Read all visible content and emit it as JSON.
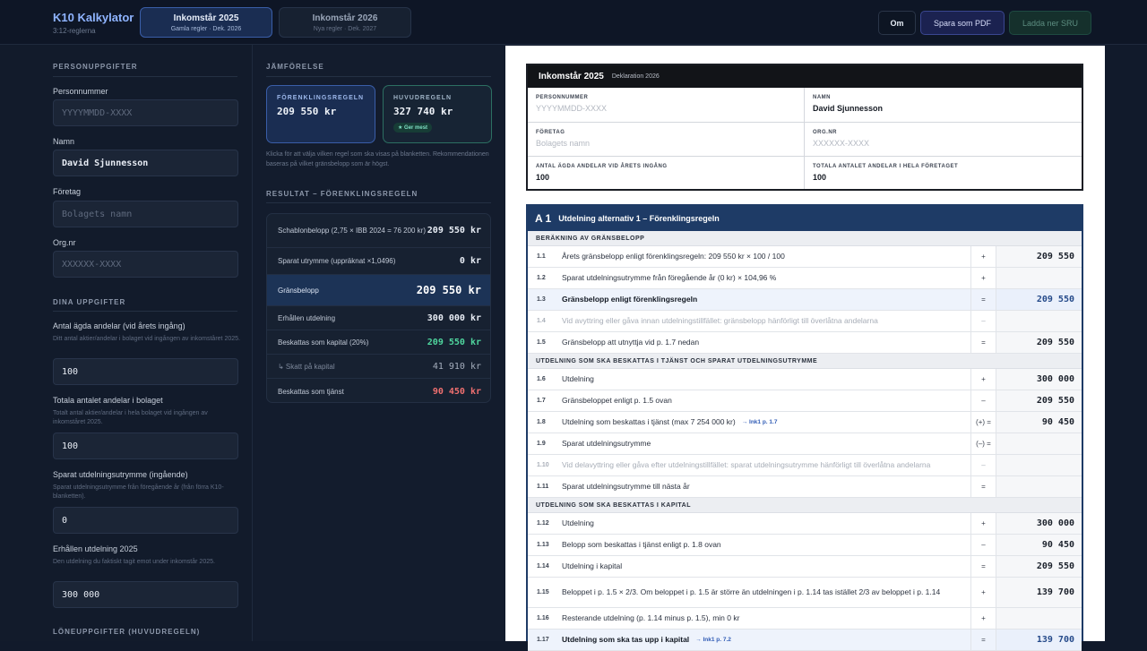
{
  "header": {
    "app_title": "K10 Kalkylator",
    "app_subtitle": "3:12-reglerna",
    "tabs": [
      {
        "label": "Inkomstår 2025",
        "sub": "Gamla regler · Dek. 2026"
      },
      {
        "label": "Inkomstår 2026",
        "sub": "Nya regler · Dek. 2027"
      }
    ],
    "buttons": {
      "about": "Om",
      "save_pdf": "Spara som PDF",
      "download_sru": "Ladda ner SRU"
    }
  },
  "left": {
    "personal_title": "PERSONUPPGIFTER",
    "personnummer_label": "Personnummer",
    "personnummer_placeholder": "YYYYMMDD-XXXX",
    "namn_label": "Namn",
    "namn_value": "David Sjunnesson",
    "foretag_label": "Företag",
    "foretag_placeholder": "Bolagets namn",
    "orgnr_label": "Org.nr",
    "orgnr_placeholder": "XXXXXX-XXXX",
    "dina_title": "DINA UPPGIFTER",
    "antal_label": "Antal ägda andelar (vid årets ingång)",
    "antal_help": "Ditt antal aktier/andelar i bolaget vid ingången av inkomståret 2025.",
    "antal_value": "100",
    "totala_label": "Totala antalet andelar i bolaget",
    "totala_help": "Totalt antal aktier/andelar i hela bolaget vid ingången av inkomståret 2025.",
    "totala_value": "100",
    "sparat_label": "Sparat utdelningsutrymme (ingående)",
    "sparat_help": "Sparat utdelningsutrymme från föregående år (från förra K10-blanketten).",
    "sparat_value": "0",
    "erhallen_label": "Erhållen utdelning 2025",
    "erhallen_help": "Den utdelning du faktiskt tagit emot under inkomstår 2025.",
    "erhallen_value": "300 000",
    "lone_title": "LÖNEUPPGIFTER (HUVUDREGELN)"
  },
  "middle": {
    "jamforelse_title": "JÄMFÖRELSE",
    "forenkling_label": "FÖRENKLINGSREGELN",
    "forenkling_value": "209 550 kr",
    "huvud_label": "HUVUDREGELN",
    "huvud_value": "327 740 kr",
    "badge": "★ Ger mest",
    "note": "Klicka för att välja vilken regel som ska visas på blanketten. Rekommendationen baseras på vilket gränsbelopp som är högst.",
    "resultat_title": "RESULTAT – FÖRENKLINGSREGELN",
    "rows": [
      {
        "label": "Schablonbelopp (2,75 × IBB 2024 = 76 200 kr)",
        "value": "209 550 kr"
      },
      {
        "label": "Sparat utrymme (uppräknat ×1,0496)",
        "value": "0 kr"
      },
      {
        "label": "Gränsbelopp",
        "value": "209 550 kr"
      },
      {
        "label": "Erhållen utdelning",
        "value": "300 000 kr"
      },
      {
        "label": "Beskattas som kapital (20%)",
        "value": "209 550 kr"
      },
      {
        "label": "↳ Skatt på kapital",
        "value": "41 910 kr"
      },
      {
        "label": "Beskattas som tjänst",
        "value": "90 450 kr"
      }
    ]
  },
  "paper": {
    "year_title": "Inkomstår 2025",
    "year_sub": "Deklaration 2026",
    "personnummer_label": "PERSONNUMMER",
    "personnummer_value": "YYYYMMDD-XXXX",
    "namn_label": "NAMN",
    "namn_value": "David Sjunnesson",
    "foretag_label": "FÖRETAG",
    "foretag_value": "Bolagets namn",
    "orgnr_label": "ORG.NR",
    "orgnr_value": "XXXXXX-XXXX",
    "antal_label": "ANTAL ÄGDA ANDELAR VID ÅRETS INGÅNG",
    "antal_value": "100",
    "totala_label": "TOTALA ANTALET ANDELAR I HELA FÖRETAGET",
    "totala_value": "100",
    "a1_num": "A 1",
    "a1_title": "Utdelning alternativ 1 – Förenklingsregeln",
    "groups": {
      "g1": "BERÄKNING AV GRÄNSBELOPP",
      "g2": "UTDELNING SOM SKA BESKATTAS I TJÄNST OCH SPARAT UTDELNINGSUTRYMME",
      "g3": "UTDELNING SOM SKA BESKATTAS I KAPITAL"
    },
    "lines": [
      {
        "no": "1.1",
        "text": "Årets gränsbelopp enligt förenklingsregeln: 209 550 kr × 100 / 100",
        "op": "+",
        "val": "209 550"
      },
      {
        "no": "1.2",
        "text": "Sparat utdelningsutrymme från föregående år (0 kr) × 104,96 %",
        "op": "+",
        "val": ""
      },
      {
        "no": "1.3",
        "text": "Gränsbelopp enligt förenklingsregeln",
        "op": "=",
        "val": "209 550"
      },
      {
        "no": "1.4",
        "text": "Vid avyttring eller gåva innan utdelningstillfället: gränsbelopp hänförligt till överlåtna andelarna",
        "op": "–",
        "val": ""
      },
      {
        "no": "1.5",
        "text": "Gränsbelopp att utnyttja vid p. 1.7 nedan",
        "op": "=",
        "val": "209 550"
      },
      {
        "no": "1.6",
        "text": "Utdelning",
        "op": "+",
        "val": "300 000"
      },
      {
        "no": "1.7",
        "text": "Gränsbeloppet enligt p. 1.5 ovan",
        "op": "–",
        "val": "209 550"
      },
      {
        "no": "1.8",
        "text": "Utdelning som beskattas i tjänst (max 7 254 000 kr)",
        "ink": "→ Ink1 p. 1.7",
        "op": "(+) =",
        "val": "90 450"
      },
      {
        "no": "1.9",
        "text": "Sparat utdelningsutrymme",
        "op": "(–) =",
        "val": ""
      },
      {
        "no": "1.10",
        "text": "Vid delavyttring eller gåva efter utdelningstillfället: sparat utdelningsutrymme hänförligt till överlåtna andelarna",
        "op": "–",
        "val": ""
      },
      {
        "no": "1.11",
        "text": "Sparat utdelningsutrymme till nästa år",
        "op": "=",
        "val": ""
      },
      {
        "no": "1.12",
        "text": "Utdelning",
        "op": "+",
        "val": "300 000"
      },
      {
        "no": "1.13",
        "text": "Belopp som beskattas i tjänst enligt p. 1.8 ovan",
        "op": "–",
        "val": "90 450"
      },
      {
        "no": "1.14",
        "text": "Utdelning i kapital",
        "op": "=",
        "val": "209 550"
      },
      {
        "no": "1.15",
        "text": "Beloppet i p. 1.5 × 2/3. Om beloppet i p. 1.5 är större än utdelningen i p. 1.14 tas istället 2/3 av beloppet i p. 1.14",
        "op": "+",
        "val": "139 700"
      },
      {
        "no": "1.16",
        "text": "Resterande utdelning (p. 1.14 minus p. 1.5), min 0 kr",
        "op": "+",
        "val": ""
      },
      {
        "no": "1.17",
        "text": "Utdelning som ska tas upp i kapital",
        "ink": "→ Ink1 p. 7.2",
        "op": "=",
        "val": "139 700"
      }
    ]
  }
}
